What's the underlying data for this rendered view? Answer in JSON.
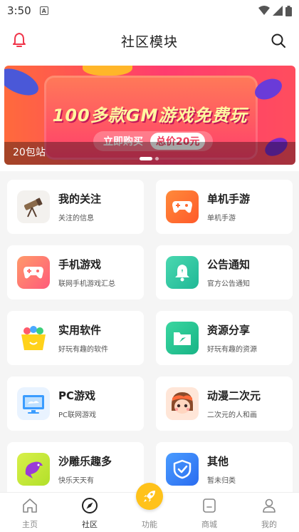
{
  "status": {
    "time": "3:50",
    "notif_letter": "A"
  },
  "header": {
    "title": "社区模块"
  },
  "banner": {
    "headline": "100多款GM游戏免费玩",
    "buy_label": "立即购买",
    "price_label": "总价20元",
    "caption": "20包站"
  },
  "tiles": [
    {
      "name": "我的关注",
      "desc": "关注的信息",
      "icon": "telescope-icon"
    },
    {
      "name": "单机手游",
      "desc": "单机手游",
      "icon": "gamepad-icon"
    },
    {
      "name": "手机游戏",
      "desc": "联网手机游戏汇总",
      "icon": "gamepad-icon"
    },
    {
      "name": "公告通知",
      "desc": "官方公告通知",
      "icon": "bell-icon"
    },
    {
      "name": "实用软件",
      "desc": "好玩有趣的软件",
      "icon": "basket-icon"
    },
    {
      "name": "资源分享",
      "desc": "好玩有趣的资源",
      "icon": "folder-share-icon"
    },
    {
      "name": "PC游戏",
      "desc": "PC联网游戏",
      "icon": "monitor-icon"
    },
    {
      "name": "动漫二次元",
      "desc": "二次元的人和画",
      "icon": "anime-avatar-icon"
    },
    {
      "name": "沙雕乐趣多",
      "desc": "快乐天天有",
      "icon": "dolphin-icon"
    },
    {
      "name": "其他",
      "desc": "暂未归类",
      "icon": "shield-check-icon"
    }
  ],
  "tabs": [
    {
      "label": "主页",
      "icon": "home-icon"
    },
    {
      "label": "社区",
      "icon": "compass-icon",
      "active": true
    },
    {
      "label": "功能",
      "icon": "rocket-icon"
    },
    {
      "label": "商城",
      "icon": "shop-icon"
    },
    {
      "label": "我的",
      "icon": "user-icon"
    }
  ],
  "colors": {
    "accent_red": "#f0364b",
    "fab_yellow": "#ffc21a"
  }
}
